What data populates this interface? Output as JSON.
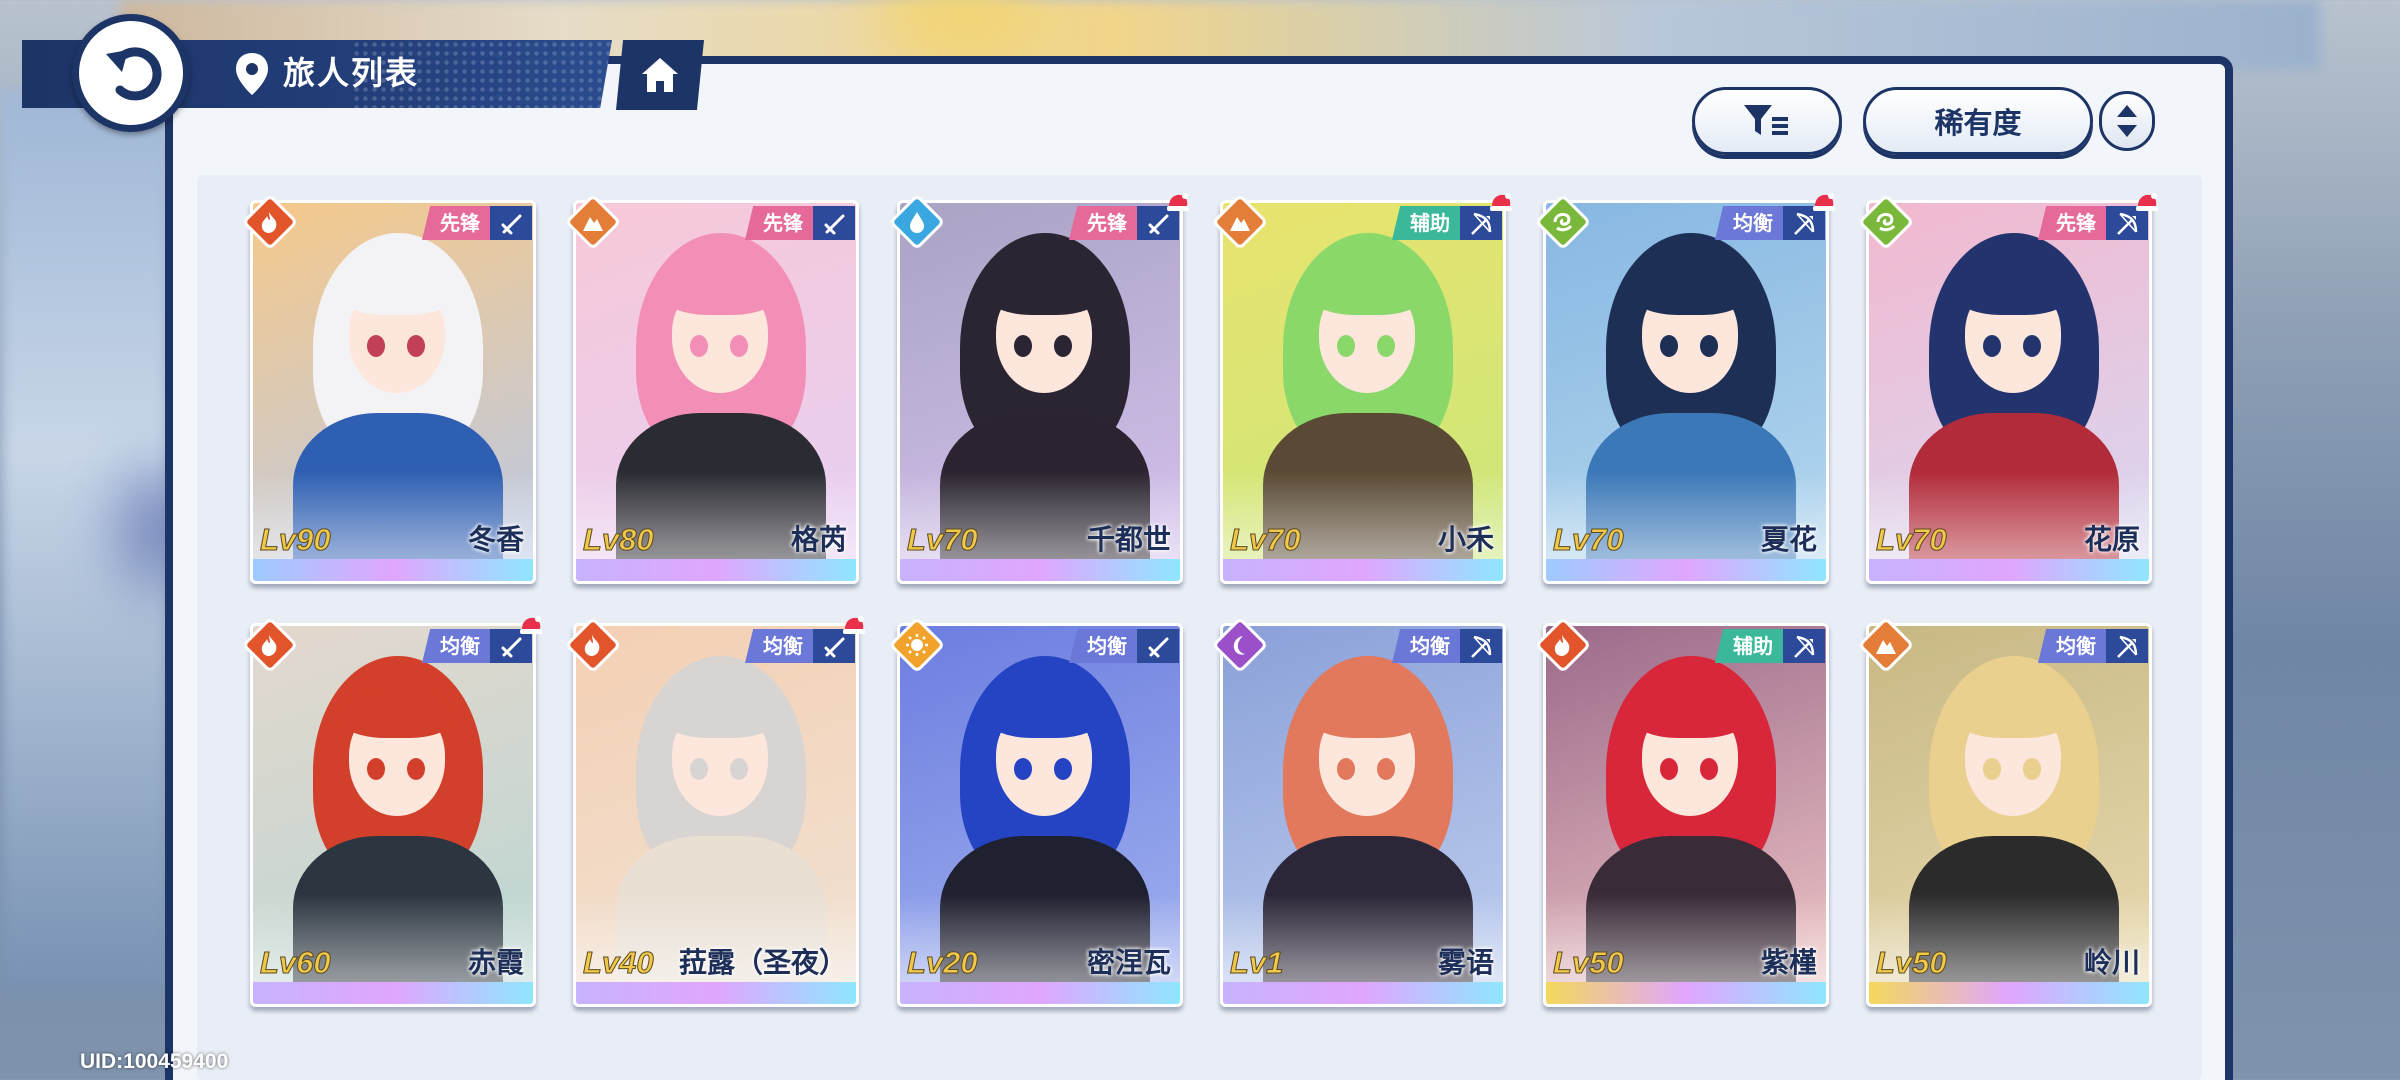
{
  "header": {
    "title": "旅人列表"
  },
  "controls": {
    "sort_label": "稀有度"
  },
  "uid": "UID:100459400",
  "colors": {
    "navy": "#1d3466",
    "role_vanguard": "#e56a9a",
    "role_support": "#3bb89a",
    "role_balance": "#6c78d8",
    "element_fire": "#e2552b",
    "element_earth": "#e47d37",
    "element_water": "#3ba7e0",
    "element_wind": "#7ab83b",
    "element_light": "#f0a22b",
    "element_dark": "#9b4fc8"
  },
  "cards": [
    {
      "level": "Lv90",
      "name": "冬香",
      "role": "先锋",
      "element": "fire-icon",
      "weapon": "sword-icon",
      "new": false
    },
    {
      "level": "Lv80",
      "name": "格芮",
      "role": "先锋",
      "element": "earth-icon",
      "weapon": "sword-icon",
      "new": false
    },
    {
      "level": "Lv70",
      "name": "千都世",
      "role": "先锋",
      "element": "water-icon",
      "weapon": "sword-icon",
      "new": true
    },
    {
      "level": "Lv70",
      "name": "小禾",
      "role": "辅助",
      "element": "earth-icon",
      "weapon": "bow-icon",
      "new": true
    },
    {
      "level": "Lv70",
      "name": "夏花",
      "role": "均衡",
      "element": "wind-icon",
      "weapon": "bow-icon",
      "new": true
    },
    {
      "level": "Lv70",
      "name": "花原",
      "role": "先锋",
      "element": "wind-icon",
      "weapon": "bow-icon",
      "new": true
    },
    {
      "level": "Lv60",
      "name": "赤霞",
      "role": "均衡",
      "element": "fire-icon",
      "weapon": "sword-icon",
      "new": true
    },
    {
      "level": "Lv40",
      "name": "菈露（圣夜）",
      "role": "均衡",
      "element": "fire-icon",
      "weapon": "sword-icon",
      "new": true
    },
    {
      "level": "Lv20",
      "name": "密涅瓦",
      "role": "均衡",
      "element": "light-icon",
      "weapon": "sword-icon",
      "new": false
    },
    {
      "level": "Lv1",
      "name": "雾语",
      "role": "均衡",
      "element": "dark-icon",
      "weapon": "bow-icon",
      "new": false
    },
    {
      "level": "Lv50",
      "name": "紫槿",
      "role": "辅助",
      "element": "fire-icon",
      "weapon": "bow-icon",
      "new": false
    },
    {
      "level": "Lv50",
      "name": "岭川",
      "role": "均衡",
      "element": "earth-icon",
      "weapon": "bow-icon",
      "new": false
    }
  ]
}
